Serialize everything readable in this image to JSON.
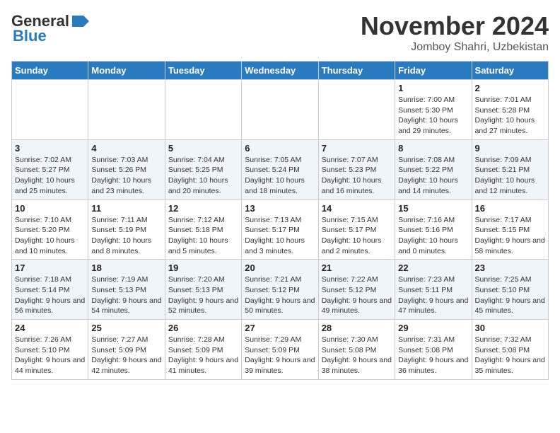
{
  "header": {
    "logo_line1": "General",
    "logo_line2": "Blue",
    "month": "November 2024",
    "location": "Jomboy Shahri, Uzbekistan"
  },
  "weekdays": [
    "Sunday",
    "Monday",
    "Tuesday",
    "Wednesday",
    "Thursday",
    "Friday",
    "Saturday"
  ],
  "weeks": [
    [
      {
        "day": "",
        "sunrise": "",
        "sunset": "",
        "daylight": ""
      },
      {
        "day": "",
        "sunrise": "",
        "sunset": "",
        "daylight": ""
      },
      {
        "day": "",
        "sunrise": "",
        "sunset": "",
        "daylight": ""
      },
      {
        "day": "",
        "sunrise": "",
        "sunset": "",
        "daylight": ""
      },
      {
        "day": "",
        "sunrise": "",
        "sunset": "",
        "daylight": ""
      },
      {
        "day": "1",
        "sunrise": "Sunrise: 7:00 AM",
        "sunset": "Sunset: 5:30 PM",
        "daylight": "Daylight: 10 hours and 29 minutes."
      },
      {
        "day": "2",
        "sunrise": "Sunrise: 7:01 AM",
        "sunset": "Sunset: 5:28 PM",
        "daylight": "Daylight: 10 hours and 27 minutes."
      }
    ],
    [
      {
        "day": "3",
        "sunrise": "Sunrise: 7:02 AM",
        "sunset": "Sunset: 5:27 PM",
        "daylight": "Daylight: 10 hours and 25 minutes."
      },
      {
        "day": "4",
        "sunrise": "Sunrise: 7:03 AM",
        "sunset": "Sunset: 5:26 PM",
        "daylight": "Daylight: 10 hours and 23 minutes."
      },
      {
        "day": "5",
        "sunrise": "Sunrise: 7:04 AM",
        "sunset": "Sunset: 5:25 PM",
        "daylight": "Daylight: 10 hours and 20 minutes."
      },
      {
        "day": "6",
        "sunrise": "Sunrise: 7:05 AM",
        "sunset": "Sunset: 5:24 PM",
        "daylight": "Daylight: 10 hours and 18 minutes."
      },
      {
        "day": "7",
        "sunrise": "Sunrise: 7:07 AM",
        "sunset": "Sunset: 5:23 PM",
        "daylight": "Daylight: 10 hours and 16 minutes."
      },
      {
        "day": "8",
        "sunrise": "Sunrise: 7:08 AM",
        "sunset": "Sunset: 5:22 PM",
        "daylight": "Daylight: 10 hours and 14 minutes."
      },
      {
        "day": "9",
        "sunrise": "Sunrise: 7:09 AM",
        "sunset": "Sunset: 5:21 PM",
        "daylight": "Daylight: 10 hours and 12 minutes."
      }
    ],
    [
      {
        "day": "10",
        "sunrise": "Sunrise: 7:10 AM",
        "sunset": "Sunset: 5:20 PM",
        "daylight": "Daylight: 10 hours and 10 minutes."
      },
      {
        "day": "11",
        "sunrise": "Sunrise: 7:11 AM",
        "sunset": "Sunset: 5:19 PM",
        "daylight": "Daylight: 10 hours and 8 minutes."
      },
      {
        "day": "12",
        "sunrise": "Sunrise: 7:12 AM",
        "sunset": "Sunset: 5:18 PM",
        "daylight": "Daylight: 10 hours and 5 minutes."
      },
      {
        "day": "13",
        "sunrise": "Sunrise: 7:13 AM",
        "sunset": "Sunset: 5:17 PM",
        "daylight": "Daylight: 10 hours and 3 minutes."
      },
      {
        "day": "14",
        "sunrise": "Sunrise: 7:15 AM",
        "sunset": "Sunset: 5:17 PM",
        "daylight": "Daylight: 10 hours and 2 minutes."
      },
      {
        "day": "15",
        "sunrise": "Sunrise: 7:16 AM",
        "sunset": "Sunset: 5:16 PM",
        "daylight": "Daylight: 10 hours and 0 minutes."
      },
      {
        "day": "16",
        "sunrise": "Sunrise: 7:17 AM",
        "sunset": "Sunset: 5:15 PM",
        "daylight": "Daylight: 9 hours and 58 minutes."
      }
    ],
    [
      {
        "day": "17",
        "sunrise": "Sunrise: 7:18 AM",
        "sunset": "Sunset: 5:14 PM",
        "daylight": "Daylight: 9 hours and 56 minutes."
      },
      {
        "day": "18",
        "sunrise": "Sunrise: 7:19 AM",
        "sunset": "Sunset: 5:13 PM",
        "daylight": "Daylight: 9 hours and 54 minutes."
      },
      {
        "day": "19",
        "sunrise": "Sunrise: 7:20 AM",
        "sunset": "Sunset: 5:13 PM",
        "daylight": "Daylight: 9 hours and 52 minutes."
      },
      {
        "day": "20",
        "sunrise": "Sunrise: 7:21 AM",
        "sunset": "Sunset: 5:12 PM",
        "daylight": "Daylight: 9 hours and 50 minutes."
      },
      {
        "day": "21",
        "sunrise": "Sunrise: 7:22 AM",
        "sunset": "Sunset: 5:12 PM",
        "daylight": "Daylight: 9 hours and 49 minutes."
      },
      {
        "day": "22",
        "sunrise": "Sunrise: 7:23 AM",
        "sunset": "Sunset: 5:11 PM",
        "daylight": "Daylight: 9 hours and 47 minutes."
      },
      {
        "day": "23",
        "sunrise": "Sunrise: 7:25 AM",
        "sunset": "Sunset: 5:10 PM",
        "daylight": "Daylight: 9 hours and 45 minutes."
      }
    ],
    [
      {
        "day": "24",
        "sunrise": "Sunrise: 7:26 AM",
        "sunset": "Sunset: 5:10 PM",
        "daylight": "Daylight: 9 hours and 44 minutes."
      },
      {
        "day": "25",
        "sunrise": "Sunrise: 7:27 AM",
        "sunset": "Sunset: 5:09 PM",
        "daylight": "Daylight: 9 hours and 42 minutes."
      },
      {
        "day": "26",
        "sunrise": "Sunrise: 7:28 AM",
        "sunset": "Sunset: 5:09 PM",
        "daylight": "Daylight: 9 hours and 41 minutes."
      },
      {
        "day": "27",
        "sunrise": "Sunrise: 7:29 AM",
        "sunset": "Sunset: 5:09 PM",
        "daylight": "Daylight: 9 hours and 39 minutes."
      },
      {
        "day": "28",
        "sunrise": "Sunrise: 7:30 AM",
        "sunset": "Sunset: 5:08 PM",
        "daylight": "Daylight: 9 hours and 38 minutes."
      },
      {
        "day": "29",
        "sunrise": "Sunrise: 7:31 AM",
        "sunset": "Sunset: 5:08 PM",
        "daylight": "Daylight: 9 hours and 36 minutes."
      },
      {
        "day": "30",
        "sunrise": "Sunrise: 7:32 AM",
        "sunset": "Sunset: 5:08 PM",
        "daylight": "Daylight: 9 hours and 35 minutes."
      }
    ]
  ]
}
